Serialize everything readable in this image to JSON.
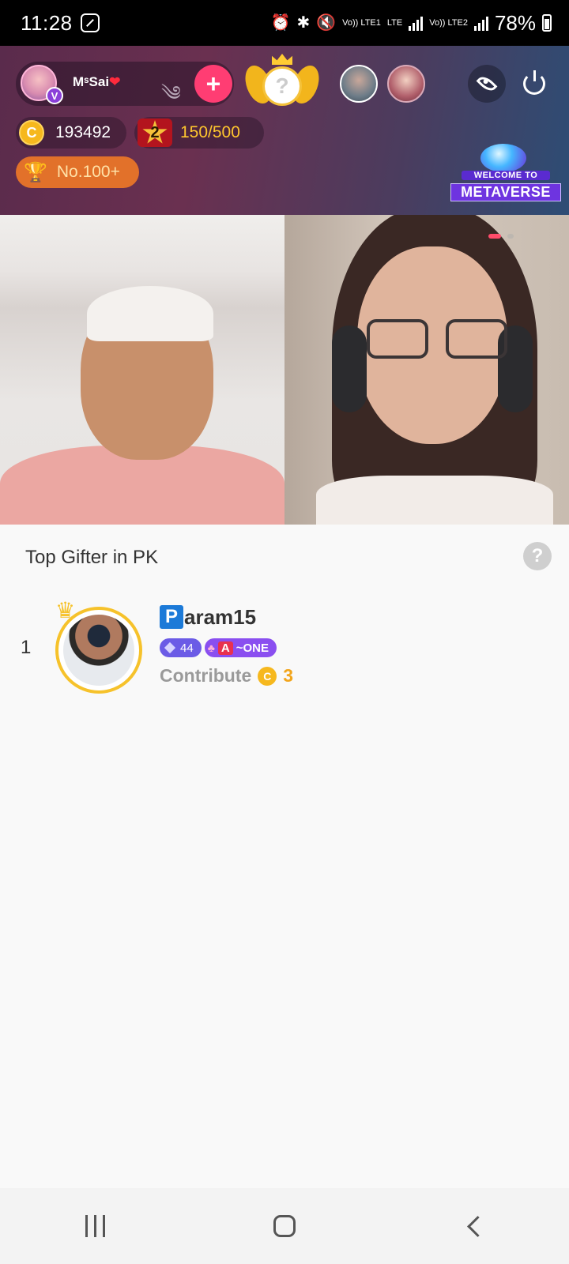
{
  "status_bar": {
    "time": "11:28",
    "lte1_label": "Vo)) LTE1",
    "lte_label": "LTE",
    "lte2_label": "Vo)) LTE2",
    "battery": "78%"
  },
  "live_header": {
    "host_name": "MˢSai",
    "host_badge": "V",
    "follow_label": "+",
    "crown_placeholder": "?",
    "coins": "193492",
    "star_level": "2",
    "star_progress": "150/500",
    "rank": "No.100+",
    "metaverse_line1": "WELCOME TO",
    "metaverse_line2": "METAVERSE"
  },
  "panel": {
    "title": "Top Gifter in PK",
    "help_label": "?",
    "gifters": [
      {
        "rank": "1",
        "name_initial": "P",
        "name_rest": "aram15",
        "level": "44",
        "club_letter": "A",
        "club_name": "~ONE",
        "contribute_label": "Contribute",
        "coin_symbol": "C",
        "contribute_value": "3"
      }
    ]
  },
  "colors": {
    "accent_pink": "#ff3d73",
    "coin_gold": "#f6b81e",
    "rank_orange": "#e2712a",
    "level_purple": "#6b5be6"
  },
  "icons": [
    "alarm-icon",
    "bluetooth-icon",
    "mute-icon",
    "signal-icon",
    "battery-icon",
    "eye-icon",
    "power-icon",
    "trophy-icon",
    "help-icon",
    "crown-icon",
    "coin-icon",
    "recents-icon",
    "home-icon",
    "back-icon"
  ]
}
